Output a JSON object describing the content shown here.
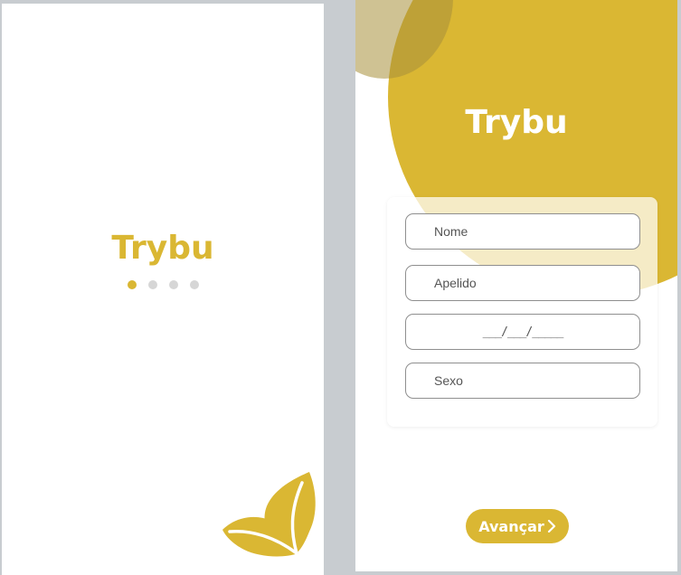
{
  "colors": {
    "brand": "#dab733",
    "brand_dark": "#a7903b",
    "dot_active": "#dab733",
    "dot_inactive": "#d6d6d6"
  },
  "splash": {
    "title": "Trybu",
    "carousel": {
      "active_index": 0,
      "count": 4
    },
    "decoration_icon": "leaves-icon"
  },
  "form": {
    "title": "Trybu",
    "fields": {
      "name_placeholder": "Nome",
      "surname_placeholder": "Apelido",
      "birthdate_placeholder": "___/___/_____",
      "gender_placeholder": "Sexo"
    },
    "next_button": {
      "label": "Avançar",
      "icon": "chevron-right-icon"
    }
  }
}
